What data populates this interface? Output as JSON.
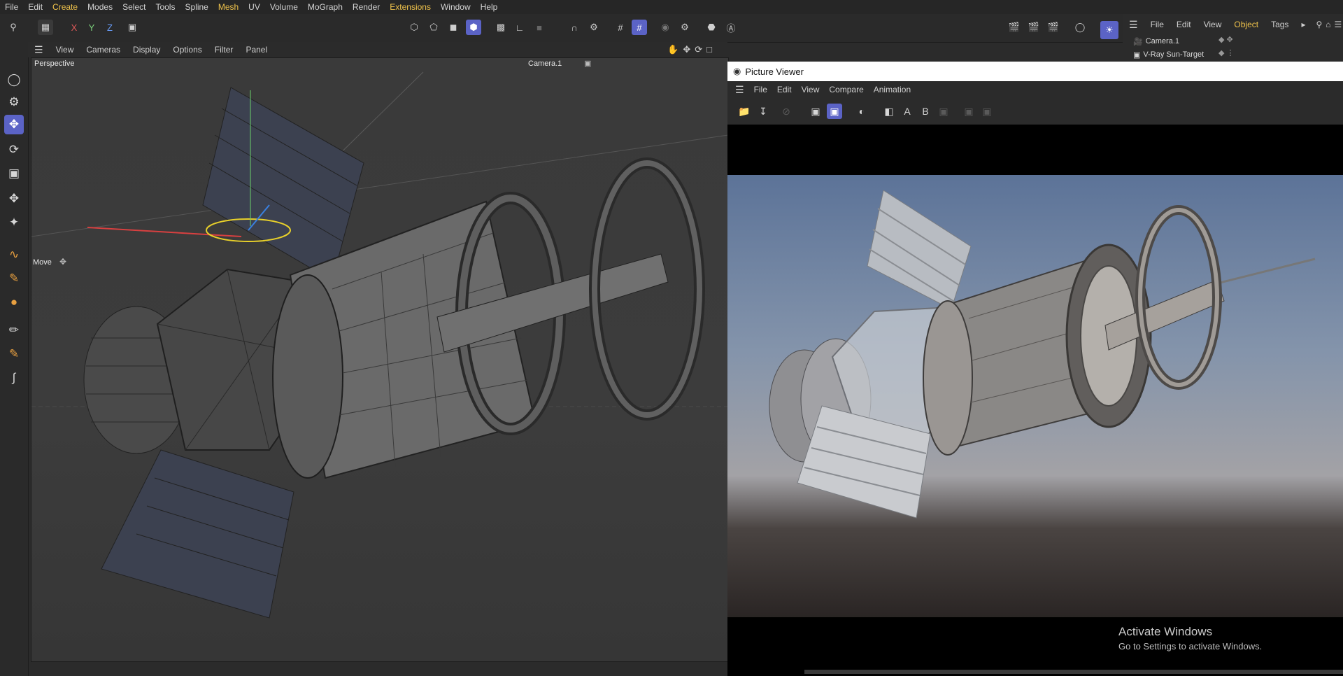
{
  "menubar": [
    "File",
    "Edit",
    "Create",
    "Modes",
    "Select",
    "Tools",
    "Spline",
    "Mesh",
    "UV",
    "Volume",
    "MoGraph",
    "Render",
    "Extensions",
    "Window",
    "Help"
  ],
  "menubar_highlight": [
    "Create",
    "Mesh",
    "Extensions"
  ],
  "axis_buttons": [
    "X",
    "Y",
    "Z"
  ],
  "viewport": {
    "menu": [
      "View",
      "Cameras",
      "Display",
      "Options",
      "Filter",
      "Panel"
    ],
    "label": "Perspective",
    "camera": "Camera.1",
    "tool_label": "Move"
  },
  "object_manager": {
    "menu": [
      "File",
      "Edit",
      "View",
      "Object",
      "Tags"
    ],
    "active_menu": "Object",
    "objects": [
      "Camera.1",
      "V-Ray Sun-Target"
    ]
  },
  "picture_viewer": {
    "title": "Picture Viewer",
    "menu": [
      "File",
      "Edit",
      "View",
      "Compare",
      "Animation"
    ],
    "compare_a": "A",
    "compare_b": "B"
  },
  "watermark": {
    "title": "Activate Windows",
    "subtitle": "Go to Settings to activate Windows."
  },
  "colors": {
    "accent": "#5b63c6",
    "highlight_menu": "#f0c34b",
    "x_axis": "#e05a5a",
    "y_axis": "#7bd17b",
    "z_axis": "#6aa0ff"
  }
}
